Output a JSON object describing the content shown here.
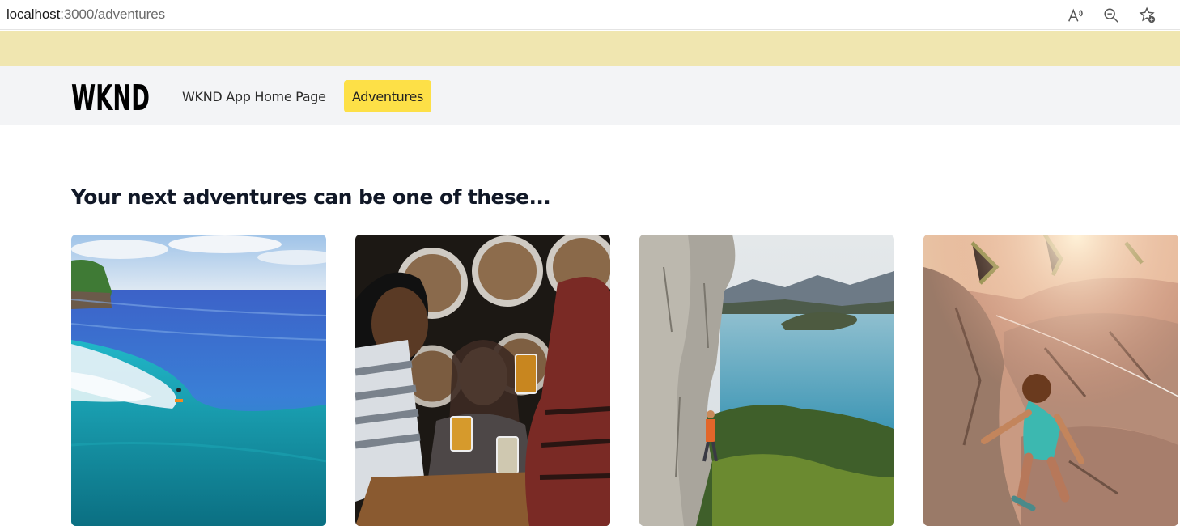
{
  "browser": {
    "url_host": "localhost",
    "url_path": ":3000/adventures",
    "toolbar_icons": [
      "read-aloud-icon",
      "zoom-icon",
      "favorite-icon"
    ]
  },
  "header": {
    "logo_text": "WKND",
    "nav": [
      {
        "label": "WKND App Home Page",
        "active": false
      },
      {
        "label": "Adventures",
        "active": true
      }
    ],
    "accent_color": "#fde047"
  },
  "main": {
    "heading": "Your next adventures can be one of these...",
    "cards": [
      {
        "image": "surfing"
      },
      {
        "image": "beer-tasting"
      },
      {
        "image": "lake-cliff-climbing"
      },
      {
        "image": "rock-climbing"
      }
    ]
  }
}
